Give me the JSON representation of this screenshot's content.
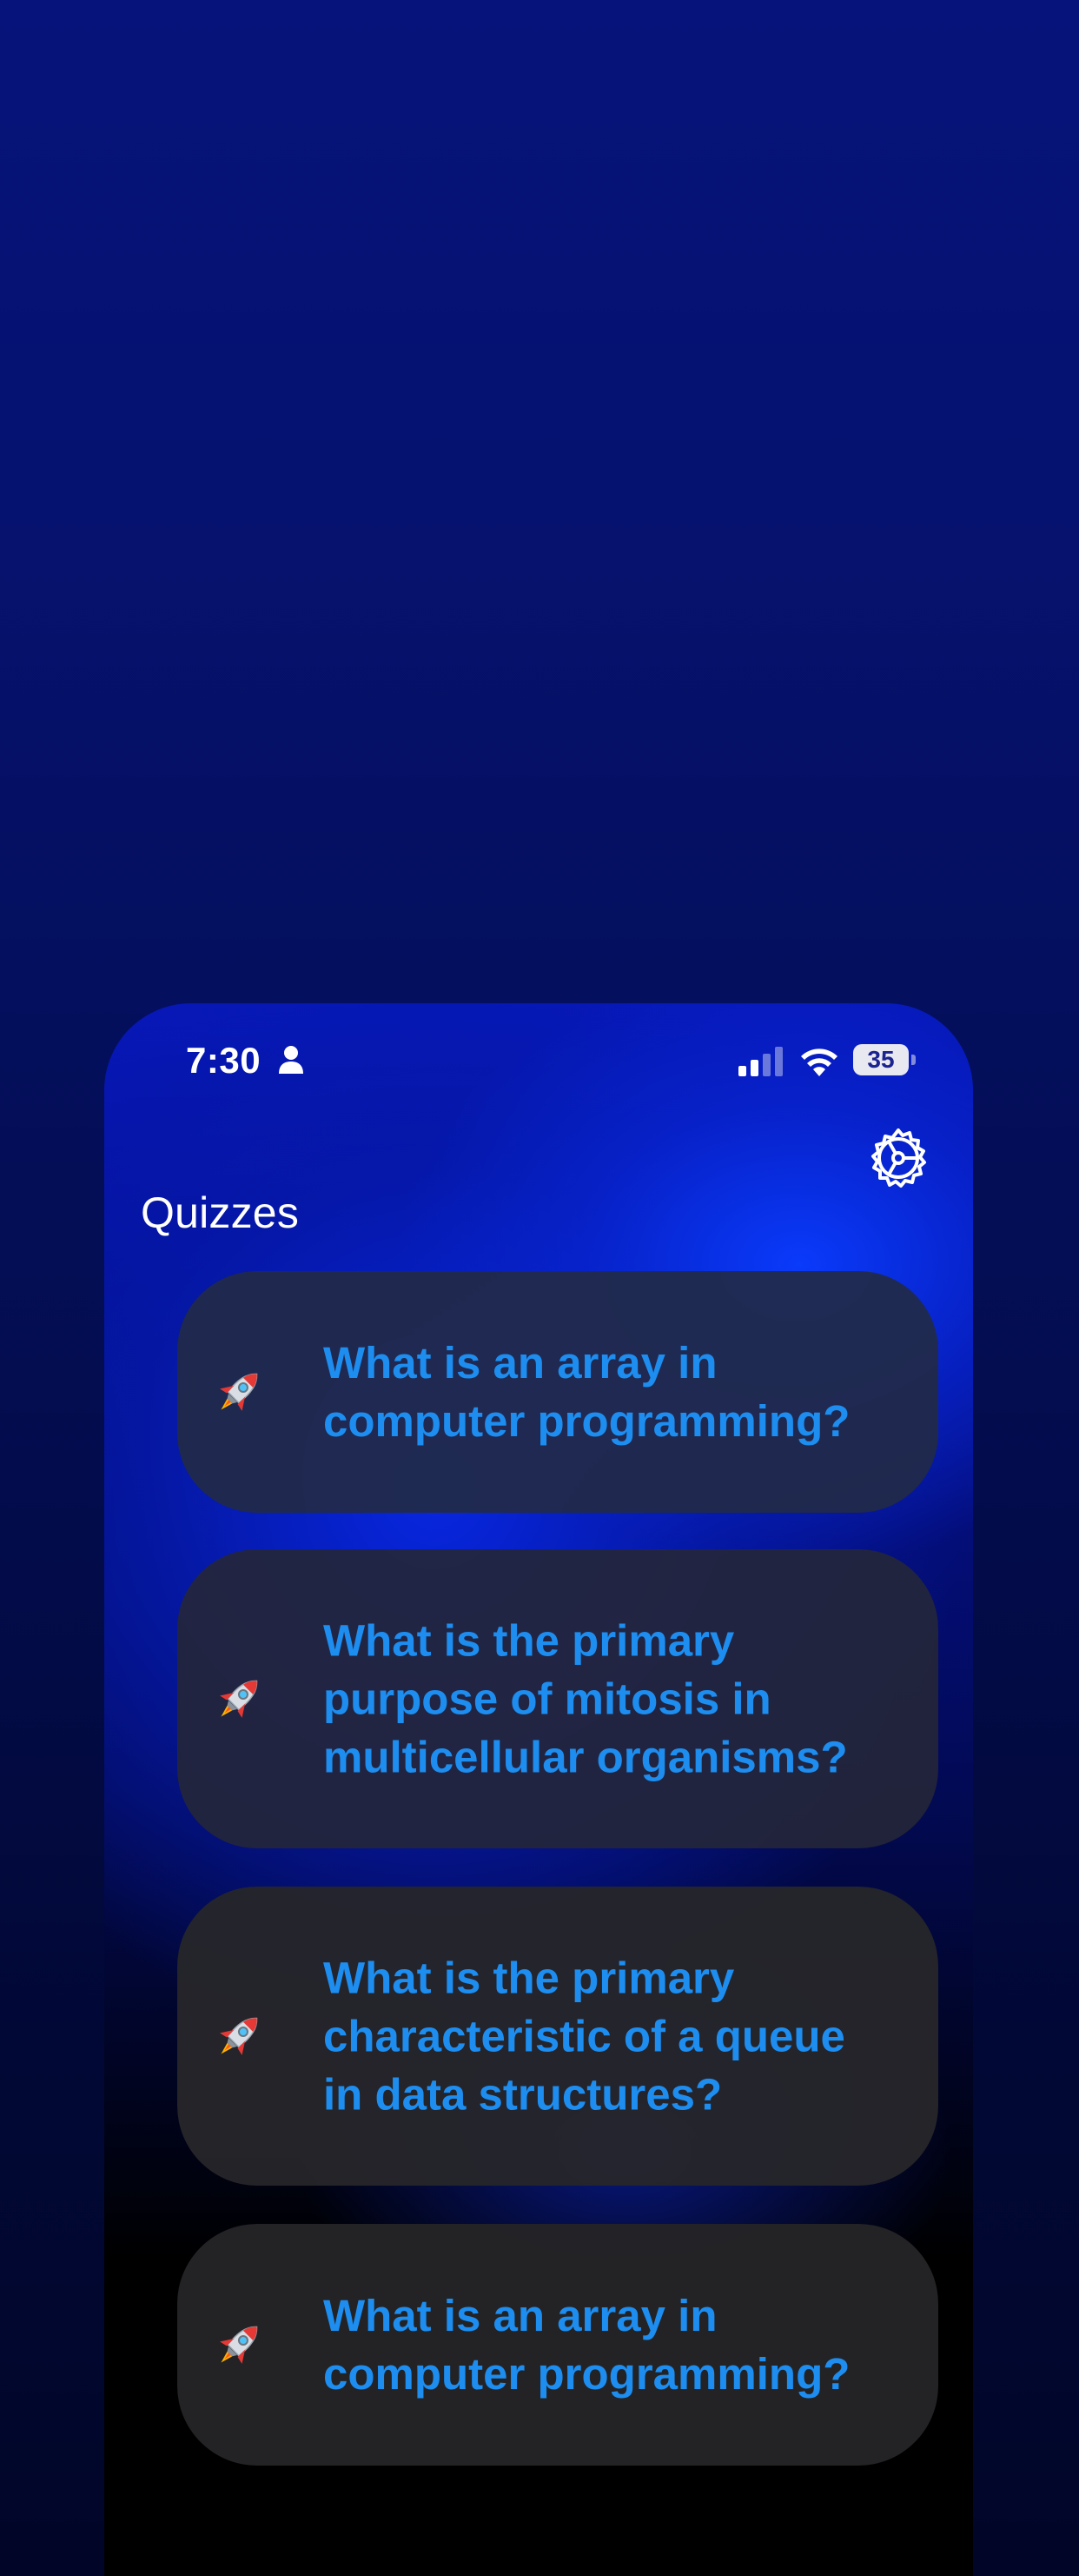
{
  "status_bar": {
    "time": "7:30",
    "battery_level": "35",
    "icons": [
      "person-icon",
      "signal-icon",
      "wifi-icon",
      "battery-icon"
    ]
  },
  "header": {
    "title": "Quizzes",
    "settings_icon": "gear-icon"
  },
  "quizzes": [
    {
      "icon": "rocket-icon",
      "question": "What is an array in computer programming?"
    },
    {
      "icon": "rocket-icon",
      "question": "What is the primary purpose of mitosis in multicellular organisms?"
    },
    {
      "icon": "rocket-icon",
      "question": "What is the primary characteristic of a queue in data structures?"
    },
    {
      "icon": "rocket-icon",
      "question": "What is an array in computer programming?"
    }
  ],
  "colors": {
    "question_text": "#1d8df0",
    "title_text": "#ffffff",
    "card_background": "#262628",
    "accent_blue": "#0a3cff"
  }
}
